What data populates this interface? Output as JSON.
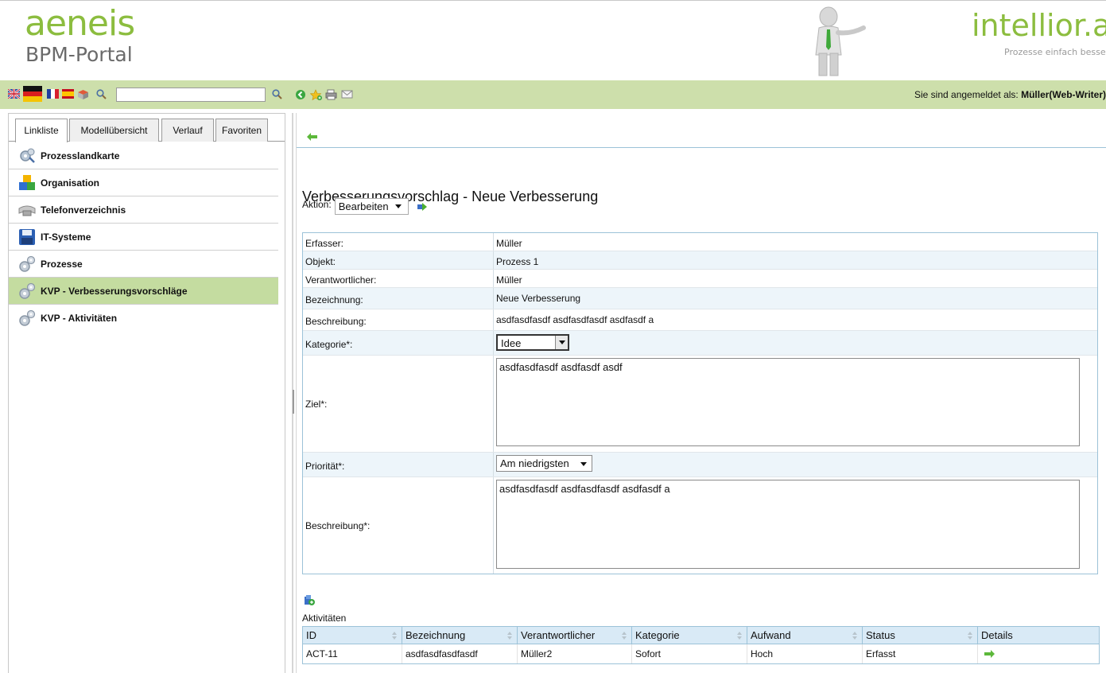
{
  "header": {
    "brand_logo": "aeneis",
    "brand_sub": "BPM-Portal",
    "partner_logo": "intellior.a",
    "partner_tagline": "Prozesse einfach besser"
  },
  "toolbar": {
    "search_value": "",
    "login_prefix": "Sie sind angemeldet als: ",
    "login_user": "Müller(Web-Writer)"
  },
  "left": {
    "tabs": [
      {
        "label": "Linkliste",
        "active": true
      },
      {
        "label": "Modellübersicht",
        "active": false
      },
      {
        "label": "Verlauf",
        "active": false
      },
      {
        "label": "Favoriten",
        "active": false
      }
    ],
    "items": [
      {
        "label": "Prozesslandkarte",
        "icon": "gears-search-icon",
        "active": false
      },
      {
        "label": "Organisation",
        "icon": "organisation-cubes-icon",
        "active": false
      },
      {
        "label": "Telefonverzeichnis",
        "icon": "phone-icon",
        "active": false
      },
      {
        "label": "IT-Systeme",
        "icon": "floppy-disk-icon",
        "active": false
      },
      {
        "label": "Prozesse",
        "icon": "gears-icon",
        "active": false
      },
      {
        "label": "KVP - Verbesserungsvorschläge",
        "icon": "gears-icon",
        "active": true
      },
      {
        "label": "KVP - Aktivitäten",
        "icon": "gears-icon",
        "active": false
      }
    ]
  },
  "main": {
    "title": "Verbesserungsvorschlag - Neue Verbesserung",
    "aktion_label": "Aktion:",
    "aktion_value": "Bearbeiten",
    "fields": {
      "erfasser_label": "Erfasser:",
      "erfasser_value": "Müller",
      "objekt_label": "Objekt:",
      "objekt_value": "Prozess 1",
      "verantwortlicher_label": "Verantwortlicher:",
      "verantwortlicher_value": "Müller",
      "bezeichnung_label": "Bezeichnung:",
      "bezeichnung_value": "Neue Verbesserung",
      "beschreibung_label": "Beschreibung:",
      "beschreibung_value": "asdfasdfasdf asdfasdfasdf asdfasdf a",
      "kategorie_label": "Kategorie*:",
      "kategorie_value": "Idee",
      "ziel_label": "Ziel*:",
      "ziel_value": "asdfasdfasdf asdfasdf asdf",
      "prioritaet_label": "Priorität*:",
      "prioritaet_value": "Am niedrigsten",
      "beschreibung2_label": "Beschreibung*:",
      "beschreibung2_value": "asdfasdfasdf asdfasdfasdf asdfasdf a"
    },
    "activities": {
      "label": "Aktivitäten",
      "columns": [
        "ID",
        "Bezeichnung",
        "Verantwortlicher",
        "Kategorie",
        "Aufwand",
        "Status",
        "Details"
      ],
      "rows": [
        {
          "id": "ACT-11",
          "bezeichnung": "asdfasdfasdfasdf",
          "verantwortlicher": "Müller2",
          "kategorie": "Sofort",
          "aufwand": "Hoch",
          "status": "Erfasst"
        }
      ]
    }
  },
  "colors": {
    "brand_green": "#8cbd3f",
    "toolbar_bg": "#cddfab",
    "active_nav": "#c4dca0",
    "row_alt": "#edf5fa",
    "border_blue": "#9cc2d8"
  }
}
